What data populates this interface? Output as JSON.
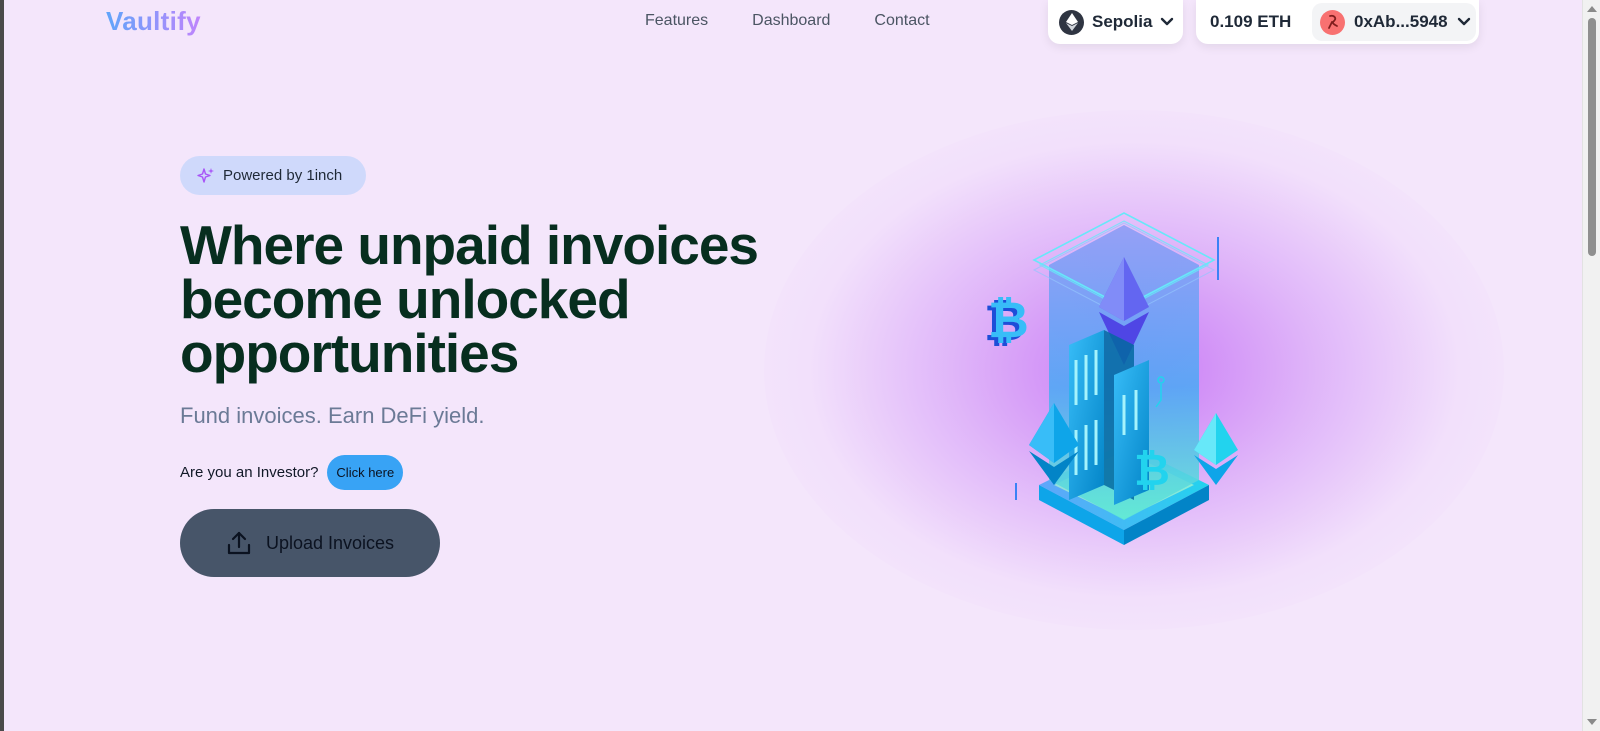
{
  "nav": {
    "logo": "Vaultify",
    "links": [
      "Features",
      "Dashboard",
      "Contact"
    ]
  },
  "network": {
    "label": "Sepolia",
    "icon": "ethereum-icon"
  },
  "wallet": {
    "balance": "0.109 ETH",
    "address": "0xAb...5948",
    "avatar_icon": "wallet-avatar-icon"
  },
  "hero": {
    "badge": "Powered by 1inch",
    "badge_icon": "sparkle-icon",
    "headline": [
      "Where unpaid invoices",
      "become unlocked",
      "opportunities"
    ],
    "subheadline": "Fund invoices. Earn DeFi yield.",
    "investor_prompt": "Are you an Investor?",
    "investor_button": "Click here",
    "upload_button": "Upload Invoices",
    "upload_icon": "upload-icon"
  },
  "colors": {
    "background": "#f4e6fb",
    "headline": "#072e1f",
    "badge_bg": "#cfd9fb",
    "click_here_bg": "#38a3f5",
    "upload_bg": "#475569",
    "logo_gradient_start": "#60a5fa",
    "logo_gradient_end": "#c084fc"
  }
}
